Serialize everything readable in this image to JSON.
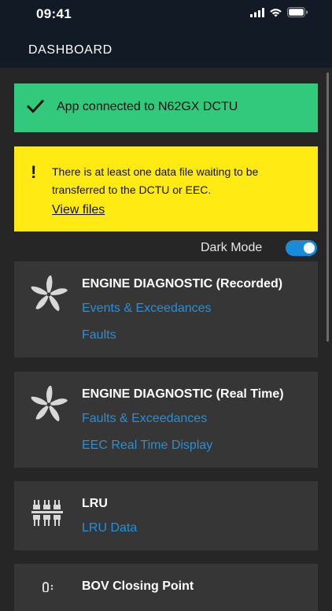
{
  "status_bar": {
    "time": "09:41"
  },
  "nav": {
    "title": "DASHBOARD"
  },
  "connection_banner": {
    "text": "App connected to N62GX DCTU"
  },
  "warning_banner": {
    "text": "There is at least one data file waiting to be transferred to the DCTU or EEC.",
    "link": "View files"
  },
  "dark_mode": {
    "label": "Dark Mode",
    "enabled": true
  },
  "cards": [
    {
      "title": "ENGINE DIAGNOSTIC (Recorded)",
      "links": [
        "Events & Exceedances",
        "Faults"
      ]
    },
    {
      "title": "ENGINE DIAGNOSTIC (Real Time)",
      "links": [
        "Faults & Exceedances",
        "EEC Real Time Display"
      ]
    },
    {
      "title": "LRU",
      "links": [
        "LRU Data"
      ]
    },
    {
      "title": "BOV Closing Point",
      "links": []
    }
  ],
  "colors": {
    "success": "#33c97d",
    "warning": "#ffea14",
    "accent": "#2a8fd4",
    "card": "#363636",
    "background": "#262626"
  }
}
